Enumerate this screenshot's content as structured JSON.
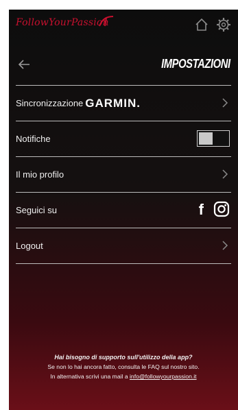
{
  "brand": {
    "logo_text": "FollowYourPassion",
    "color": "#c8102e"
  },
  "topbar": {
    "home_icon": "home-icon",
    "settings_icon": "gear-icon"
  },
  "header": {
    "title": "IMPOSTAZIONI",
    "back_icon": "arrow-left-icon"
  },
  "menu": {
    "sync": {
      "label": "Sincronizzazione",
      "brand": "GARMIN."
    },
    "notifications": {
      "label": "Notifiche",
      "enabled": false
    },
    "profile": {
      "label": "Il mio profilo"
    },
    "follow": {
      "label": "Seguici su",
      "facebook_glyph": "f"
    },
    "logout": {
      "label": "Logout"
    }
  },
  "footer": {
    "question": "Hai bisogno di supporto sull'utilizzo della app?",
    "line1": "Se non lo hai ancora fatto, consulta le FAQ sul nostro sito.",
    "line2_prefix": "In alternativa scrivi una mail a",
    "email": "info@followyourpassion.it"
  }
}
